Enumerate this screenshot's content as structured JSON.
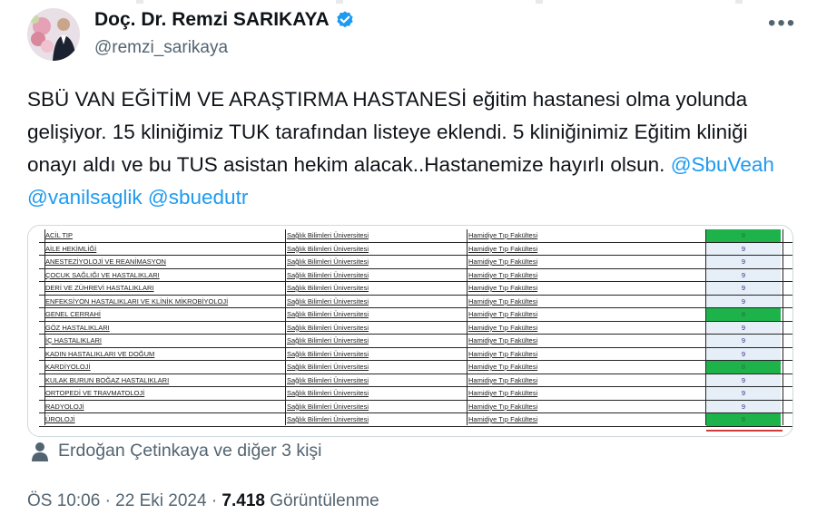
{
  "author": {
    "name": "Doç. Dr. Remzi SARIKAYA",
    "handle": "@remzi_sarikaya",
    "verified": true,
    "icons": {
      "verified": "verified-badge-icon",
      "more": "more-options-icon"
    }
  },
  "tweet": {
    "text_part1": "SBÜ VAN EĞİTİM VE ARAŞTIRMA HASTANESİ eğitim hastanesi olma yolunda gelişiyor. 15 kliniğimiz TUK tarafından listeye eklendi. 5 kliniğinimiz Eğitim kliniği onayı aldı ve bu TUS asistan hekim alacak..Hastanemize hayırlı olsun. ",
    "mentions": [
      "@SbuVeah",
      "@vanilsaglik",
      "@sbuedutr"
    ]
  },
  "table": {
    "rows": [
      {
        "clinic": "ACİL TIP",
        "university": "Sağlık Bilimleri Üniversitesi",
        "faculty": "Hamidiye Tıp Fakültesi",
        "value": "8",
        "highlight": true
      },
      {
        "clinic": "AİLE HEKİMLİĞİ",
        "university": "Sağlık Bilimleri Üniversitesi",
        "faculty": "Hamidiye Tıp Fakültesi",
        "value": "9",
        "highlight": false
      },
      {
        "clinic": "ANESTEZİYOLOJİ VE REANİMASYON",
        "university": "Sağlık Bilimleri Üniversitesi",
        "faculty": "Hamidiye Tıp Fakültesi",
        "value": "9",
        "highlight": false
      },
      {
        "clinic": "ÇOCUK SAĞLIĞI VE HASTALIKLARI",
        "university": "Sağlık Bilimleri Üniversitesi",
        "faculty": "Hamidiye Tıp Fakültesi",
        "value": "9",
        "highlight": false
      },
      {
        "clinic": "DERİ VE ZÜHREVİ HASTALIKLARI",
        "university": "Sağlık Bilimleri Üniversitesi",
        "faculty": "Hamidiye Tıp Fakültesi",
        "value": "9",
        "highlight": false
      },
      {
        "clinic": "ENFEKSİYON HASTALIKLARI VE KLİNİK MİKROBİYOLOJİ",
        "university": "Sağlık Bilimleri Üniversitesi",
        "faculty": "Hamidiye Tıp Fakültesi",
        "value": "9",
        "highlight": false
      },
      {
        "clinic": "GENEL CERRAHİ",
        "university": "Sağlık Bilimleri Üniversitesi",
        "faculty": "Hamidiye Tıp Fakültesi",
        "value": "8",
        "highlight": true
      },
      {
        "clinic": "GÖZ HASTALIKLARI",
        "university": "Sağlık Bilimleri Üniversitesi",
        "faculty": "Hamidiye Tıp Fakültesi",
        "value": "9",
        "highlight": false
      },
      {
        "clinic": "İÇ HASTALIKLARI",
        "university": "Sağlık Bilimleri Üniversitesi",
        "faculty": "Hamidiye Tıp Fakültesi",
        "value": "9",
        "highlight": false
      },
      {
        "clinic": "KADIN HASTALIKLARI VE DOĞUM",
        "university": "Sağlık Bilimleri Üniversitesi",
        "faculty": "Hamidiye Tıp Fakültesi",
        "value": "9",
        "highlight": false
      },
      {
        "clinic": "KARDİYOLOJİ",
        "university": "Sağlık Bilimleri Üniversitesi",
        "faculty": "Hamidiye Tıp Fakültesi",
        "value": "8",
        "highlight": true
      },
      {
        "clinic": "KULAK BURUN BOĞAZ HASTALIKLARI",
        "university": "Sağlık Bilimleri Üniversitesi",
        "faculty": "Hamidiye Tıp Fakültesi",
        "value": "9",
        "highlight": false
      },
      {
        "clinic": "ORTOPEDİ VE TRAVMATOLOJİ",
        "university": "Sağlık Bilimleri Üniversitesi",
        "faculty": "Hamidiye Tıp Fakültesi",
        "value": "9",
        "highlight": false
      },
      {
        "clinic": "RADYOLOJİ",
        "university": "Sağlık Bilimleri Üniversitesi",
        "faculty": "Hamidiye Tıp Fakültesi",
        "value": "9",
        "highlight": false
      },
      {
        "clinic": "ÜROLOJİ",
        "university": "Sağlık Bilimleri Üniversitesi",
        "faculty": "Hamidiye Tıp Fakültesi",
        "value": "8",
        "highlight": true
      }
    ]
  },
  "likes": {
    "text": "Erdoğan Çetinkaya ve diğer 3 kişi",
    "icon": "person-icon"
  },
  "meta": {
    "time": "ÖS 10:06",
    "separator": "·",
    "date": "22 Eki 2024",
    "views_count": "7.418",
    "views_label": "Görüntülenme"
  },
  "colors": {
    "text": "#0f1419",
    "muted": "#536471",
    "link": "#1d9bf0",
    "verified": "#1d9bf0",
    "highlight_green": "#1db34a"
  }
}
